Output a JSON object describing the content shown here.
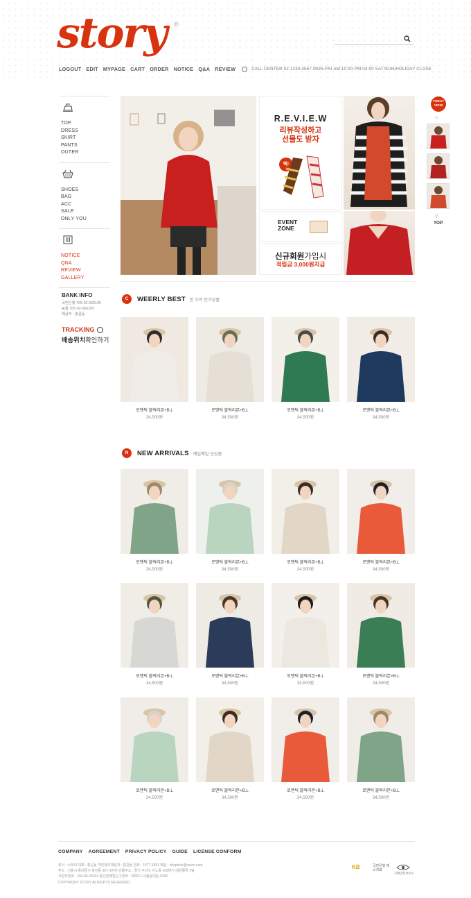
{
  "brand": {
    "logo": "story",
    "reg": "®",
    "accent": "#d8330f"
  },
  "search": {
    "icon": "magnifier-icon"
  },
  "topnav": {
    "items": [
      "LOGOUT",
      "EDIT",
      "MYPAGE",
      "CART",
      "ORDER",
      "NOTICE",
      "Q&A",
      "REVIEW"
    ],
    "call_center": "CALL CENTER 02.1234.4567  MON-FRI AM:10:00-PM:04:00  SAT/SUN/HOLIDAY CLOSE"
  },
  "sidebar": {
    "group1": [
      "TOP",
      "DRESS",
      "SKIRT",
      "PANTS",
      "OUTER"
    ],
    "group2": [
      "SHOES",
      "BAG",
      "ACC",
      "SALE",
      "ONLY YOU"
    ],
    "group3": [
      "NOTICE",
      "QNA",
      "REVIEW",
      "GALLERY"
    ],
    "bank": {
      "title": "BANK INFO",
      "lines": [
        "국민은행   705-02-266105",
        "농협        705-02-266105",
        "예금주 : 홍길동"
      ]
    },
    "tracking": {
      "title": "TRACKING",
      "sub_bold": "배송위치",
      "sub_rest": "확인하기"
    }
  },
  "banner": {
    "review_title": "R.E.V.I.E.W",
    "review_line1": "리뷰작성하고",
    "review_line2": "선물도 받자",
    "review_badge": "텍!",
    "event_title": "EVENT ZONE",
    "member_bold": "신규회원",
    "member_rest": "가입시",
    "member_reward": "적립금 3,000원지급"
  },
  "today_view": {
    "badge": "TODAY VIEW",
    "up": "^",
    "down": "v",
    "top": "TOP"
  },
  "weekly_best": {
    "dot": "C",
    "title": "WEERLY BEST",
    "sub": "한 주의 인기상품",
    "products": [
      {
        "name": "로맨틱 블럭리본+B.L",
        "price": "34,500원"
      },
      {
        "name": "로맨틱 블럭리본+B.L",
        "price": "34,500원"
      },
      {
        "name": "로맨틱 블럭리본+B.L",
        "price": "34,500원"
      },
      {
        "name": "로맨틱 블럭리본+B.L",
        "price": "34,500원"
      }
    ]
  },
  "new_arrivals": {
    "dot": "N",
    "title": "NEW ARRIVALS",
    "sub": "매일매일 신상품",
    "products": [
      {
        "name": "로맨틱 블럭리본+B.L",
        "price": "34,500원"
      },
      {
        "name": "로맨틱 블럭리본+B.L",
        "price": "34,500원"
      },
      {
        "name": "로맨틱 블럭리본+B.L",
        "price": "34,500원"
      },
      {
        "name": "로맨틱 블럭리본+B.L",
        "price": "34,500원"
      },
      {
        "name": "로맨틱 블럭리본+B.L",
        "price": "34,500원"
      },
      {
        "name": "로맨틱 블럭리본+B.L",
        "price": "34,500원"
      },
      {
        "name": "로맨틱 블럭리본+B.L",
        "price": "34,500원"
      },
      {
        "name": "로맨틱 블럭리본+B.L",
        "price": "34,500원"
      },
      {
        "name": "로맨틱 블럭리본+B.L",
        "price": "34,500원"
      },
      {
        "name": "로맨틱 블럭리본+B.L",
        "price": "34,500원"
      },
      {
        "name": "로맨틱 블럭리본+B.L",
        "price": "34,500원"
      },
      {
        "name": "로맨틱 블럭리본+B.L",
        "price": "34,500원"
      }
    ]
  },
  "footer": {
    "nav": [
      "COMPANY",
      "AGREEMENT",
      "PRIVACY POLICY",
      "GUIDE",
      "LICENSE CONFORM"
    ],
    "info1": "회사 : 스토리   대표 : 홍길동   개인정보책임자 : 홍길동   전화 : 1577-1551   메일 : shopskin@naver.com",
    "info2": "주소 : 서울시 동대문구 장안동 367-3번지   반품주소 : 경기 구리시 사노동 358번지 대원물류 1팀",
    "info3": "사업자번호 : 204-86-25024   통신판매업신고번호 : 제2011-서울동대문-0345",
    "copyright": "COPYRIGHT STORY All RIGHTS RESERVED.",
    "kb": "KB",
    "kb_sub": "국민은행 에스크로",
    "eye_text": "구매안전서비스"
  }
}
